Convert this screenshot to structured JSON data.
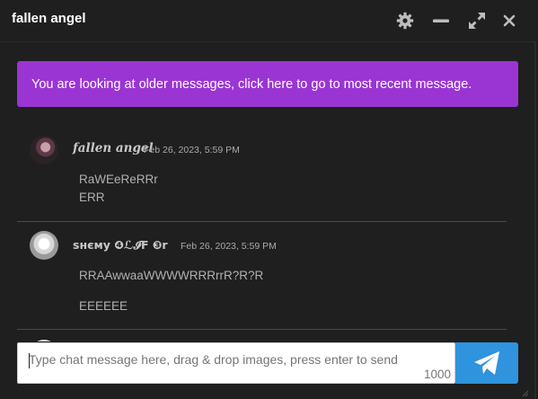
{
  "window": {
    "title": "fallen angel",
    "controls": {
      "settings_icon": "gear-icon",
      "minimize_icon": "minus-icon",
      "expand_icon": "expand-arrows-icon",
      "close_icon": "close-icon"
    }
  },
  "notice": {
    "text": "You are looking at older messages, click here to go to most recent message.",
    "color": "#9a35d4"
  },
  "messages": [
    {
      "username": "𝒇𝒂𝒍𝒍𝒆𝒏 𝒂𝒏𝒈𝒆𝒍",
      "timestamp": "Feb 26, 2023, 5:59 PM",
      "lines": [
        "RaWEeReRRr",
        "ERR"
      ]
    },
    {
      "username": "ѕнємy ❹ℒ𝓘F ❸r",
      "timestamp": "Feb 26, 2023, 5:59 PM",
      "lines": [
        "RRAAwwaaWWWWRRRrrR?R?R",
        "EEEEEE"
      ]
    }
  ],
  "composer": {
    "placeholder": "Type chat message here, drag & drop images, press enter to send",
    "char_limit": "1000",
    "send_icon": "paper-plane-icon",
    "send_color": "#2f93dd"
  }
}
